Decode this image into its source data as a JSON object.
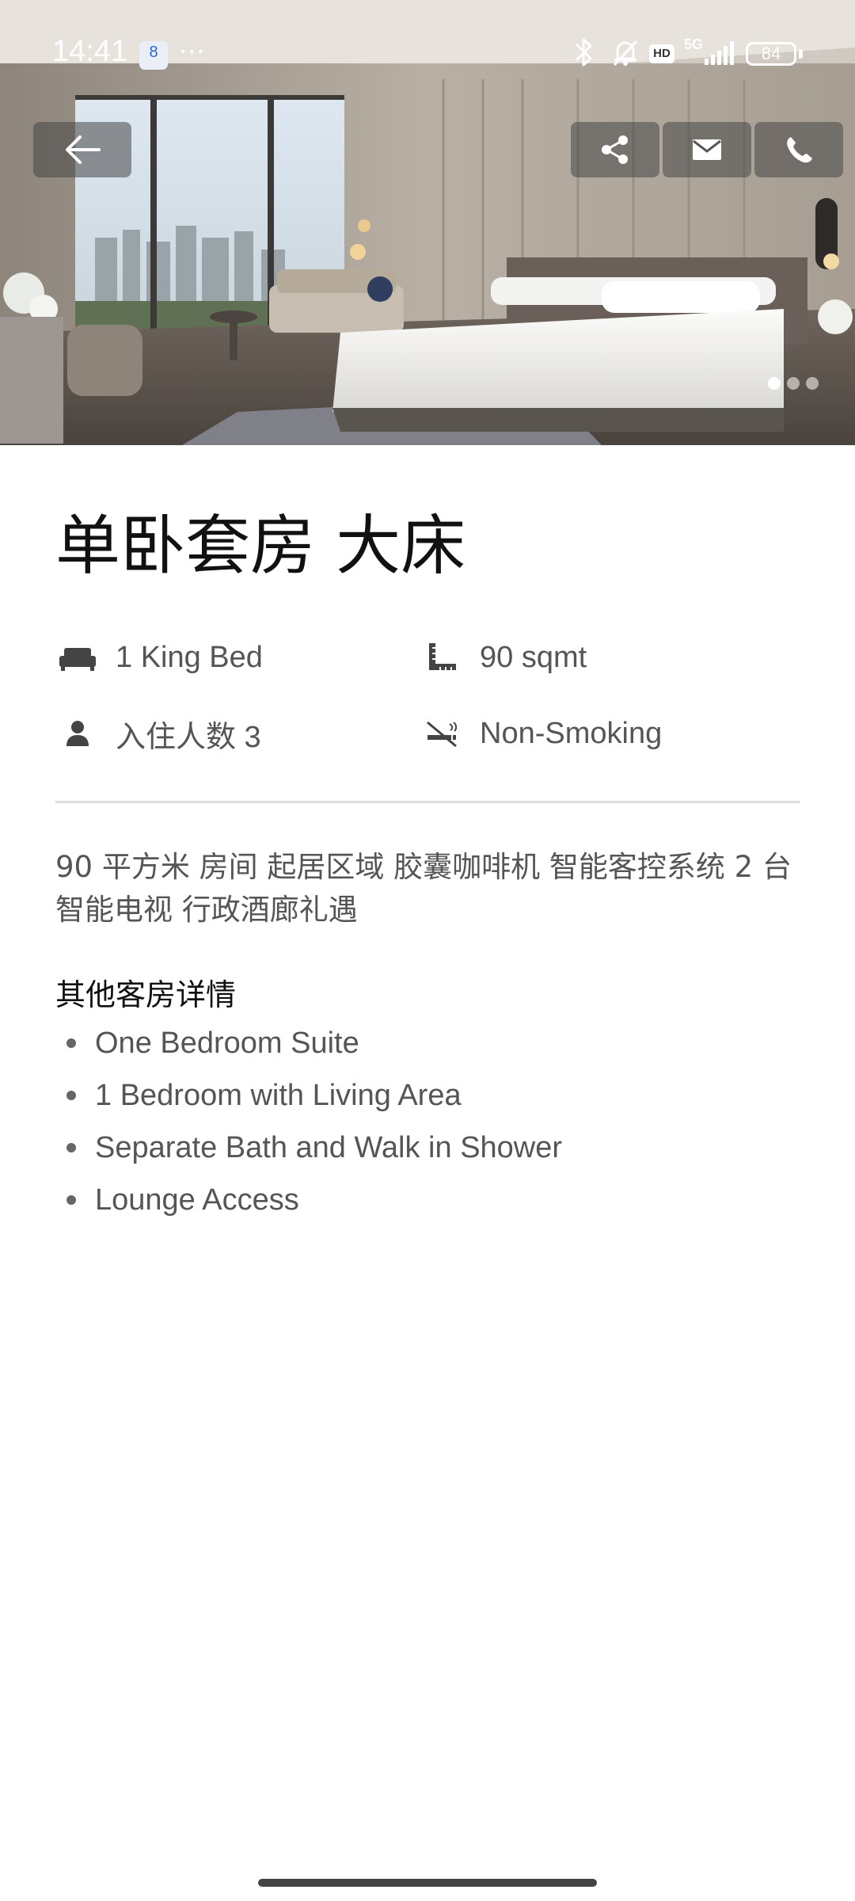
{
  "status_bar": {
    "time": "14:41",
    "calendar_day": "8",
    "more": "···",
    "network": "5G",
    "hd_badge": "HD",
    "battery": "84",
    "icons": [
      "bluetooth-icon",
      "mute-bell-icon",
      "hd-icon",
      "signal-5g-icon",
      "battery-icon"
    ]
  },
  "hero": {
    "image": "hotel-room-photo",
    "actions": {
      "back": "back-arrow-icon",
      "share": "share-icon",
      "email": "mail-icon",
      "call": "phone-icon"
    },
    "carousel": {
      "count": 3,
      "active_index": 0
    }
  },
  "room": {
    "title": "单卧套房 大床",
    "features": [
      {
        "icon": "bed-icon",
        "text": "1 King Bed"
      },
      {
        "icon": "ruler-icon",
        "text": "90 sqmt"
      },
      {
        "icon": "person-icon",
        "text": "入住人数 3"
      },
      {
        "icon": "no-smoking-icon",
        "text": "Non-Smoking"
      }
    ],
    "description": "90 平方米 房间  起居区域 胶囊咖啡机 智能客控系统 2 台智能电视 行政酒廊礼遇",
    "details_heading": "其他客房详情",
    "details": [
      "One Bedroom Suite",
      "1 Bedroom with Living Area",
      "Separate Bath and Walk in Shower",
      "Lounge Access"
    ]
  },
  "colors": {
    "text_primary": "#111111",
    "text_secondary": "#555555",
    "divider": "#dcdcdc",
    "overlay_button": "#464646"
  }
}
